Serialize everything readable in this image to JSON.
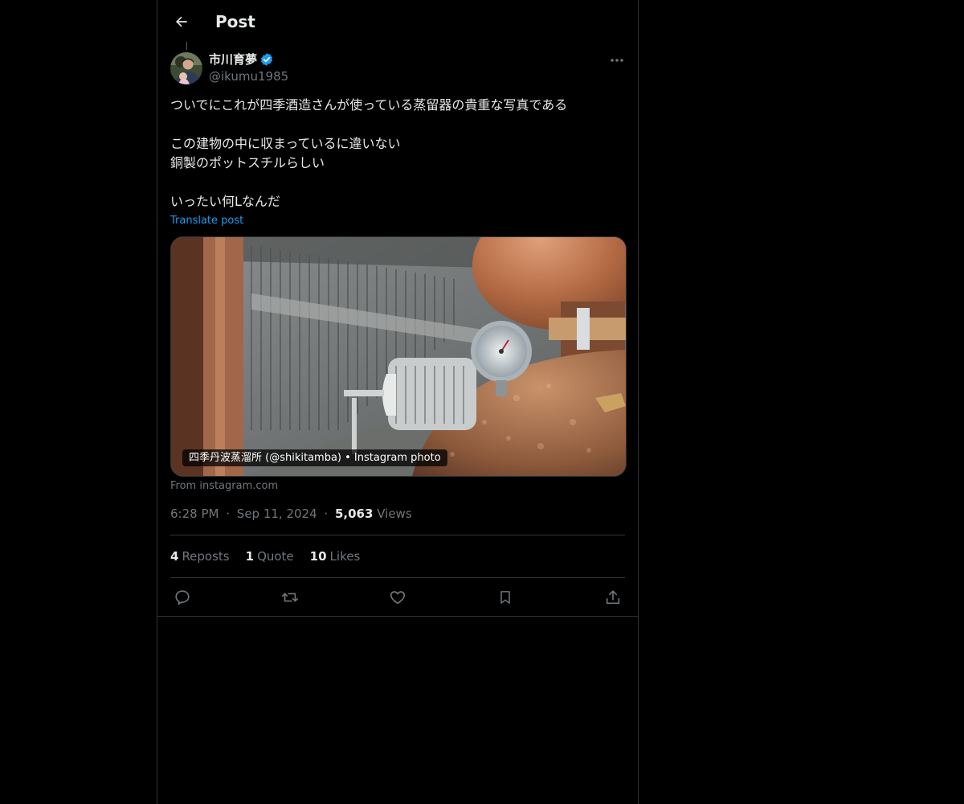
{
  "header": {
    "title": "Post"
  },
  "author": {
    "display_name": "市川育夢",
    "handle": "@ikumu1985"
  },
  "post": {
    "lines": [
      "ついでにこれが四季酒造さんが使っている蒸留器の貴重な写真である",
      "",
      "この建物の中に収まっているに違いない",
      "銅製のポットスチルらしい",
      "",
      "いったい何Lなんだ"
    ],
    "translate_label": "Translate post"
  },
  "media": {
    "caption": "四季丹波蒸溜所 (@shikitamba) • Instagram photo",
    "source": "From instagram.com"
  },
  "meta": {
    "time": "6:28 PM",
    "date": "Sep 11, 2024",
    "views_count": "5,063",
    "views_label": "Views",
    "separator": "·"
  },
  "stats": {
    "reposts_count": "4",
    "reposts_label": "Reposts",
    "quotes_count": "1",
    "quotes_label": "Quote",
    "likes_count": "10",
    "likes_label": "Likes"
  },
  "icons": {
    "back": "arrow-left-icon",
    "verified": "verified-badge-icon",
    "more": "more-horizontal-icon",
    "reply": "reply-icon",
    "repost": "repost-icon",
    "like": "heart-icon",
    "bookmark": "bookmark-icon",
    "share": "share-icon"
  },
  "colors": {
    "background": "#000000",
    "text": "#e7e9ea",
    "secondary": "#71767b",
    "accent": "#1d9bf0",
    "border": "#2f3336"
  }
}
